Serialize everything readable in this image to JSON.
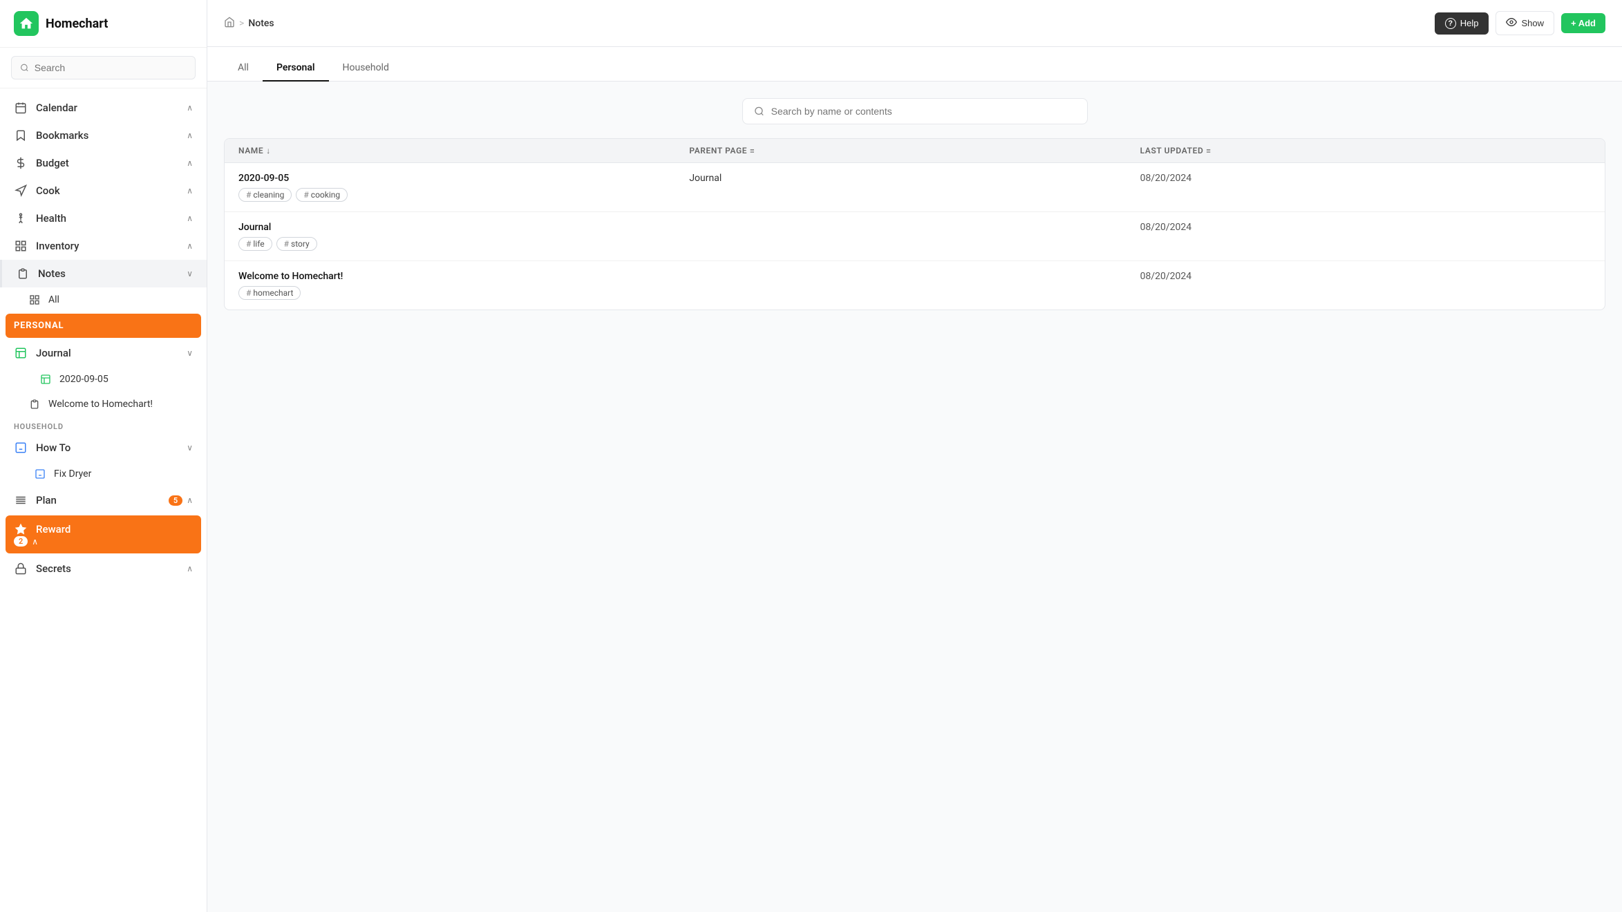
{
  "app": {
    "name": "Homechart",
    "logo_char": "🏠"
  },
  "sidebar": {
    "search_placeholder": "Search",
    "nav_items": [
      {
        "id": "calendar",
        "label": "Calendar",
        "icon": "calendar-icon",
        "has_chevron": true
      },
      {
        "id": "bookmarks",
        "label": "Bookmarks",
        "icon": "bookmarks-icon",
        "has_chevron": true
      },
      {
        "id": "budget",
        "label": "Budget",
        "icon": "budget-icon",
        "has_chevron": true
      },
      {
        "id": "cook",
        "label": "Cook",
        "icon": "cook-icon",
        "has_chevron": true
      },
      {
        "id": "health",
        "label": "Health",
        "icon": "health-icon",
        "has_chevron": true
      },
      {
        "id": "inventory",
        "label": "Inventory",
        "icon": "inventory-icon",
        "has_chevron": true
      },
      {
        "id": "notes",
        "label": "Notes",
        "icon": "notes-icon",
        "has_chevron": true,
        "active": true
      }
    ],
    "notes_sub": {
      "all_label": "All",
      "personal_label": "PERSONAL",
      "journal_label": "Journal",
      "journal_sub": [
        {
          "label": "2020-09-05"
        }
      ],
      "welcome_label": "Welcome to Homechart!",
      "household_label": "HOUSEHOLD",
      "howto_label": "How To",
      "howto_sub": [
        {
          "label": "Fix Dryer"
        }
      ]
    },
    "bottom_nav": [
      {
        "id": "plan",
        "label": "Plan",
        "badge": "5",
        "icon": "plan-icon",
        "has_chevron": true
      },
      {
        "id": "reward",
        "label": "Reward",
        "badge": "2",
        "icon": "reward-icon",
        "has_chevron": true,
        "active_orange": true
      },
      {
        "id": "secrets",
        "label": "Secrets",
        "icon": "secrets-icon",
        "has_chevron": true
      }
    ]
  },
  "header": {
    "breadcrumb_home": "🏠",
    "breadcrumb_sep": ">",
    "breadcrumb_current": "Notes",
    "btn_help": "Help",
    "btn_show": "Show",
    "btn_add": "+ Add"
  },
  "tabs": [
    {
      "id": "all",
      "label": "All",
      "active": false
    },
    {
      "id": "personal",
      "label": "Personal",
      "active": true
    },
    {
      "id": "household",
      "label": "Household",
      "active": false
    }
  ],
  "notes_search": {
    "placeholder": "Search by name or contents"
  },
  "table": {
    "columns": [
      {
        "id": "name",
        "label": "NAME",
        "icon": "sort-asc-icon"
      },
      {
        "id": "parent_page",
        "label": "PARENT PAGE",
        "icon": "filter-icon"
      },
      {
        "id": "last_updated",
        "label": "LAST UPDATED",
        "icon": "filter-icon"
      }
    ],
    "rows": [
      {
        "name": "2020-09-05",
        "tags": [
          "cleaning",
          "cooking"
        ],
        "parent_page": "Journal",
        "last_updated": "08/20/2024"
      },
      {
        "name": "Journal",
        "tags": [
          "life",
          "story"
        ],
        "parent_page": "",
        "last_updated": "08/20/2024"
      },
      {
        "name": "Welcome to Homechart!",
        "tags": [
          "homechart"
        ],
        "parent_page": "",
        "last_updated": "08/20/2024"
      }
    ]
  }
}
